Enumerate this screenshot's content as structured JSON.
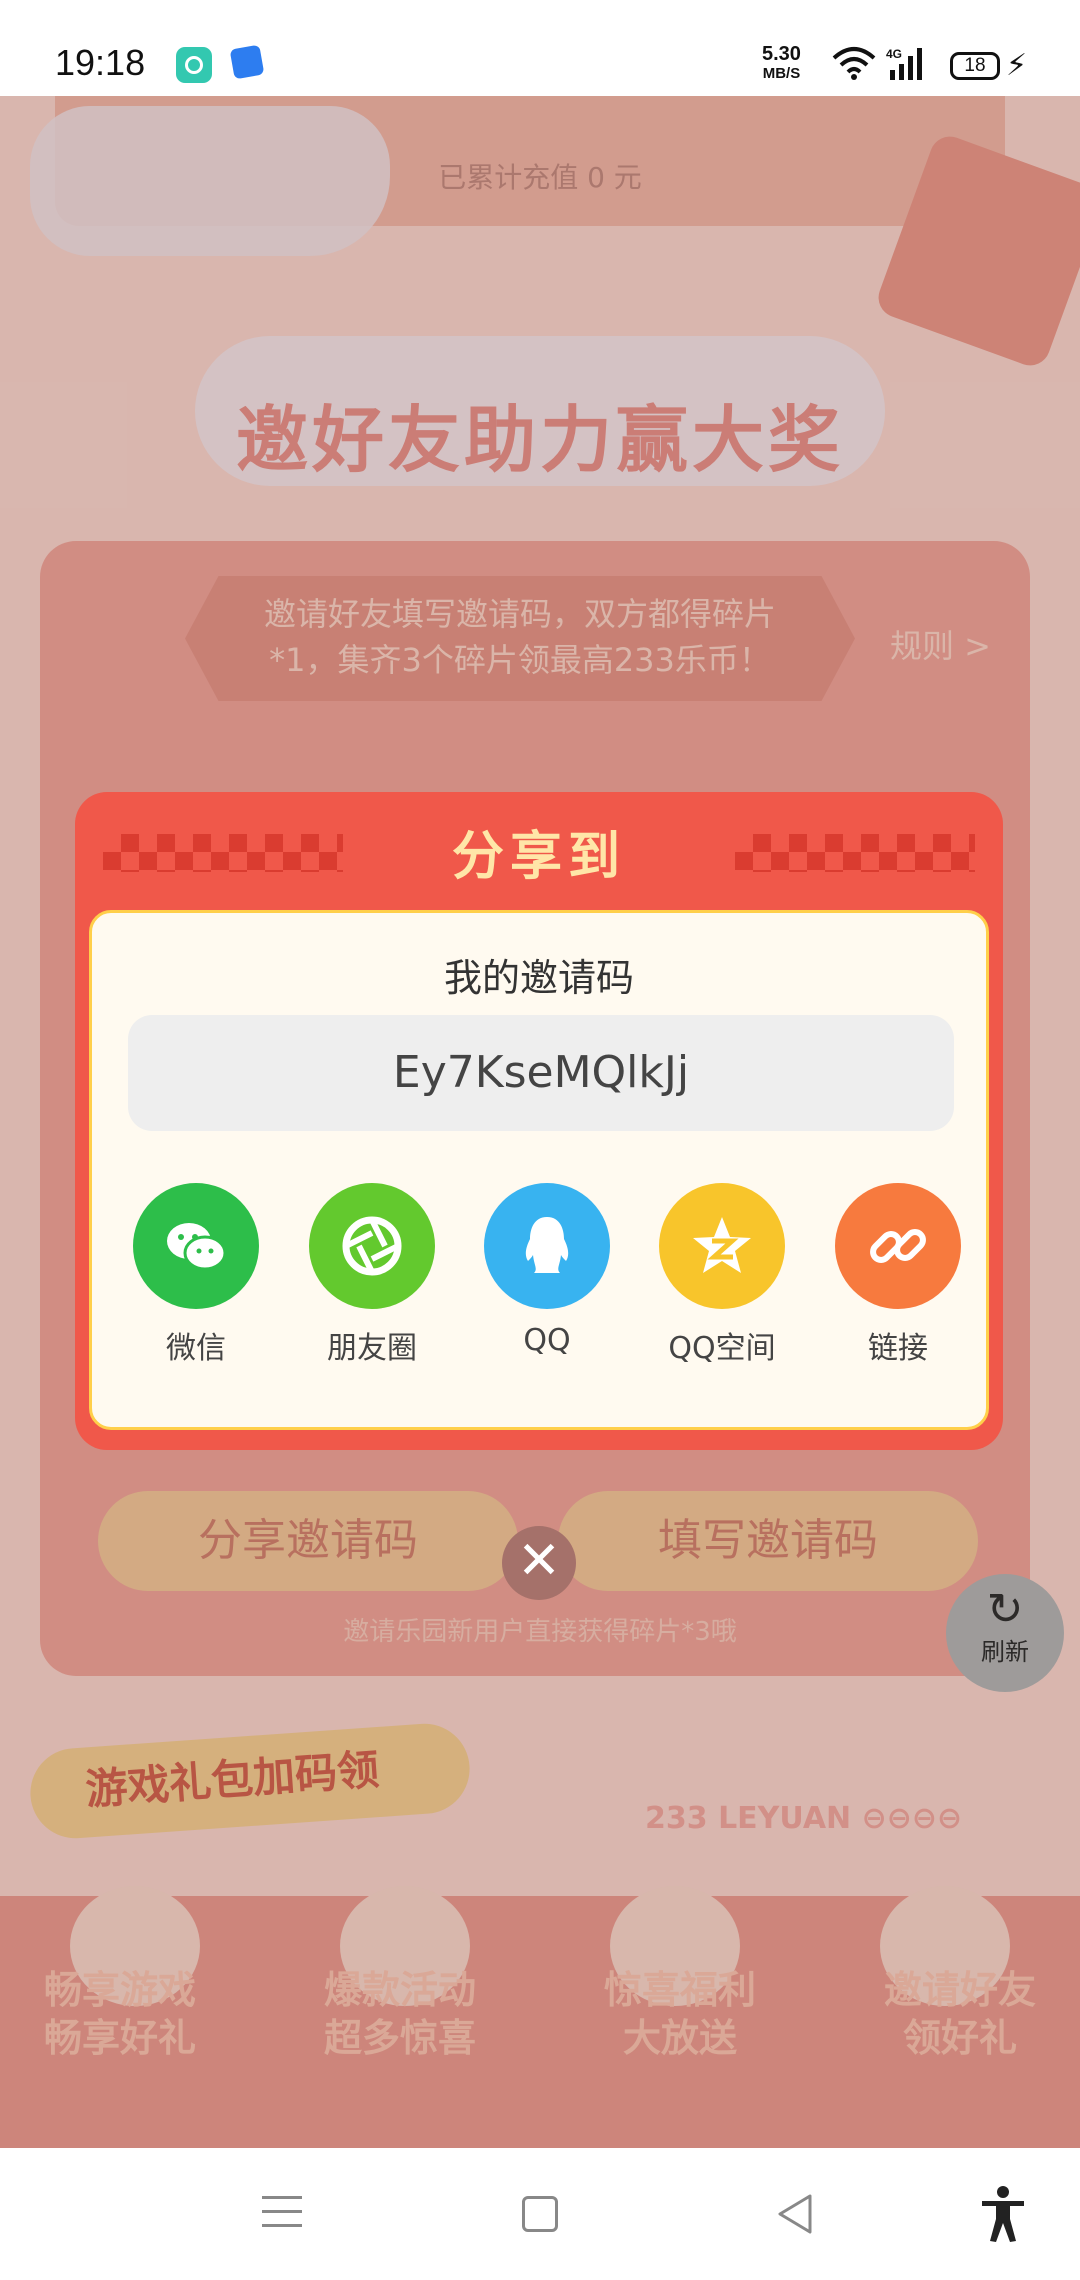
{
  "status_bar": {
    "time": "19:18",
    "net_speed_value": "5.30",
    "net_speed_unit": "MB/S",
    "network_type": "4G",
    "battery": "18"
  },
  "background": {
    "recharge_text": "已累计充值 0 元",
    "hero_title": "邀好友助力赢大奖",
    "tip_text": "邀请好友填写邀请码，双方都得碎片*1，集齐3个碎片领最高233乐币！",
    "rules_label": "规则 >",
    "share_code_button": "分享邀请码",
    "fill_code_button": "填写邀请码",
    "note": "邀请乐园新用户直接获得碎片*3哦",
    "refresh_label": "刷新",
    "gift_tag": "游戏礼包加码领",
    "leyuan": "233 LEYUAN",
    "features": [
      "畅享游戏\n畅享好礼",
      "爆款活动\n超多惊喜",
      "惊喜福利\n大放送",
      "邀请好友\n领好礼"
    ]
  },
  "dialog": {
    "title": "分享到",
    "code_label": "我的邀请码",
    "invite_code": "Ey7KseMQlkJj",
    "share_targets": [
      {
        "label": "微信",
        "icon": "wechat-icon",
        "color": "#2dbe4a"
      },
      {
        "label": "朋友圈",
        "icon": "moments-icon",
        "color": "#63c92e"
      },
      {
        "label": "QQ",
        "icon": "qq-icon",
        "color": "#38b3f0"
      },
      {
        "label": "QQ空间",
        "icon": "qzone-icon",
        "color": "#f8c52b"
      },
      {
        "label": "链接",
        "icon": "link-icon",
        "color": "#f77a3e"
      }
    ]
  },
  "colors": {
    "dialog_red": "#f0584a",
    "title_yellow": "#ffe6a8",
    "inner_cream": "#fffaf0"
  }
}
